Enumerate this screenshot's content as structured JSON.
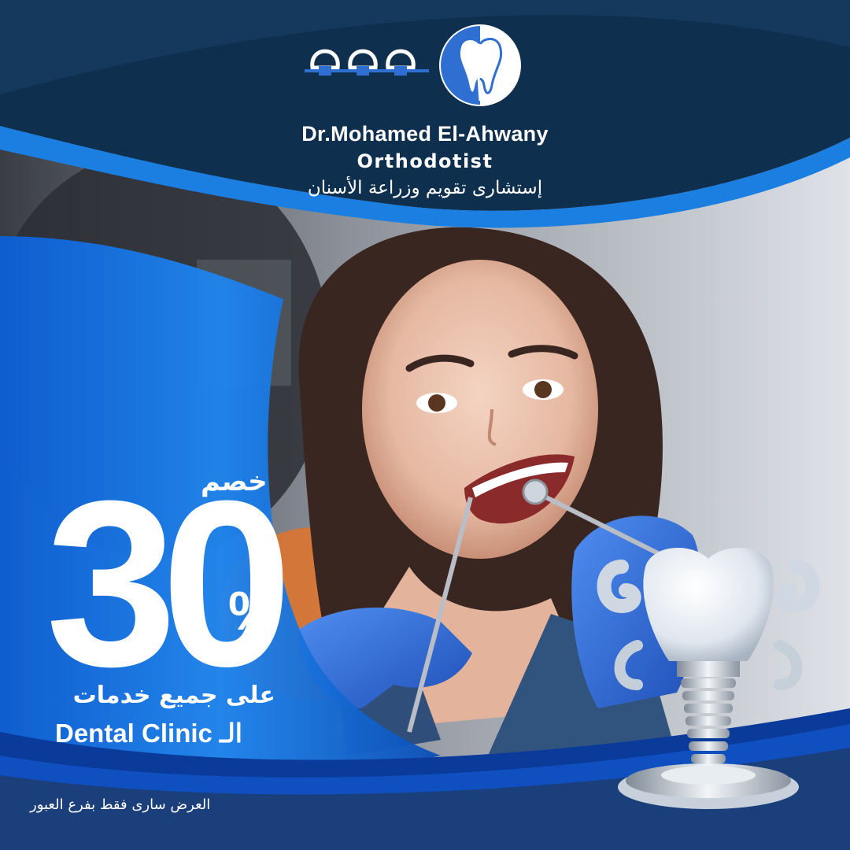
{
  "brand": {
    "name": "Dr.Mohamed El-Ahwany",
    "title": "Orthodotist",
    "subtitle_ar": "إستشارى تقويم وزراعة الأسنان"
  },
  "offer": {
    "discount_word": "خصم",
    "discount_value": "30",
    "percent_sign": "%",
    "line1": "على جميع خدمات",
    "line2": "Dental Clinic الـ",
    "footnote": "العرض سارى فقط بفرع العبور"
  },
  "colors": {
    "navy": "#0f2f4f",
    "accent_blue": "#1a7fe0",
    "light_blue": "#3aa0f5",
    "white": "#ffffff"
  },
  "icons": {
    "logo_braces": "braces-icon",
    "logo_tooth": "tooth-icon",
    "implant": "dental-implant-icon"
  }
}
